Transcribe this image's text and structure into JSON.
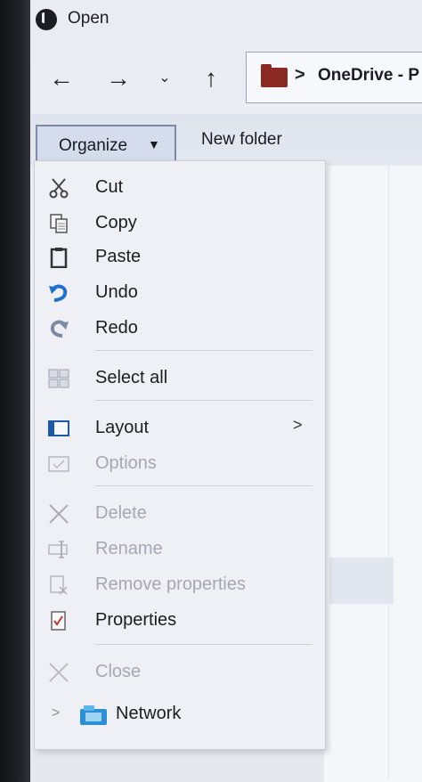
{
  "window": {
    "title": "Open"
  },
  "nav": {
    "back": "←",
    "forward": "→",
    "recent": "⌄",
    "up": "↑",
    "address_separator": ">",
    "address": "OneDrive - P"
  },
  "toolbar": {
    "organize": "Organize",
    "organize_caret": "▼",
    "new_folder": "New folder"
  },
  "menu": {
    "items": [
      {
        "label": "Cut",
        "icon": "scissors-icon",
        "enabled": true
      },
      {
        "label": "Copy",
        "icon": "copy-icon",
        "enabled": true
      },
      {
        "label": "Paste",
        "icon": "paste-icon",
        "enabled": true
      },
      {
        "label": "Undo",
        "icon": "undo-icon",
        "enabled": true
      },
      {
        "label": "Redo",
        "icon": "redo-icon",
        "enabled": true
      },
      {
        "label": "Select all",
        "icon": "select-all-icon",
        "enabled": true
      },
      {
        "label": "Layout",
        "icon": "layout-icon",
        "enabled": true,
        "submenu": ">"
      },
      {
        "label": "Options",
        "icon": "options-icon",
        "enabled": false
      },
      {
        "label": "Delete",
        "icon": "delete-icon",
        "enabled": false
      },
      {
        "label": "Rename",
        "icon": "rename-icon",
        "enabled": false
      },
      {
        "label": "Remove properties",
        "icon": "remove-properties-icon",
        "enabled": false
      },
      {
        "label": "Properties",
        "icon": "properties-icon",
        "enabled": true
      },
      {
        "label": "Close",
        "icon": "close-icon",
        "enabled": false
      }
    ]
  },
  "sidebar": {
    "network": {
      "label": "Network",
      "chevron": ">"
    }
  },
  "colors": {
    "undo_blue": "#1f6fd0",
    "folder_red": "#8b2a22",
    "disabled_text": "#a4a8b2"
  }
}
